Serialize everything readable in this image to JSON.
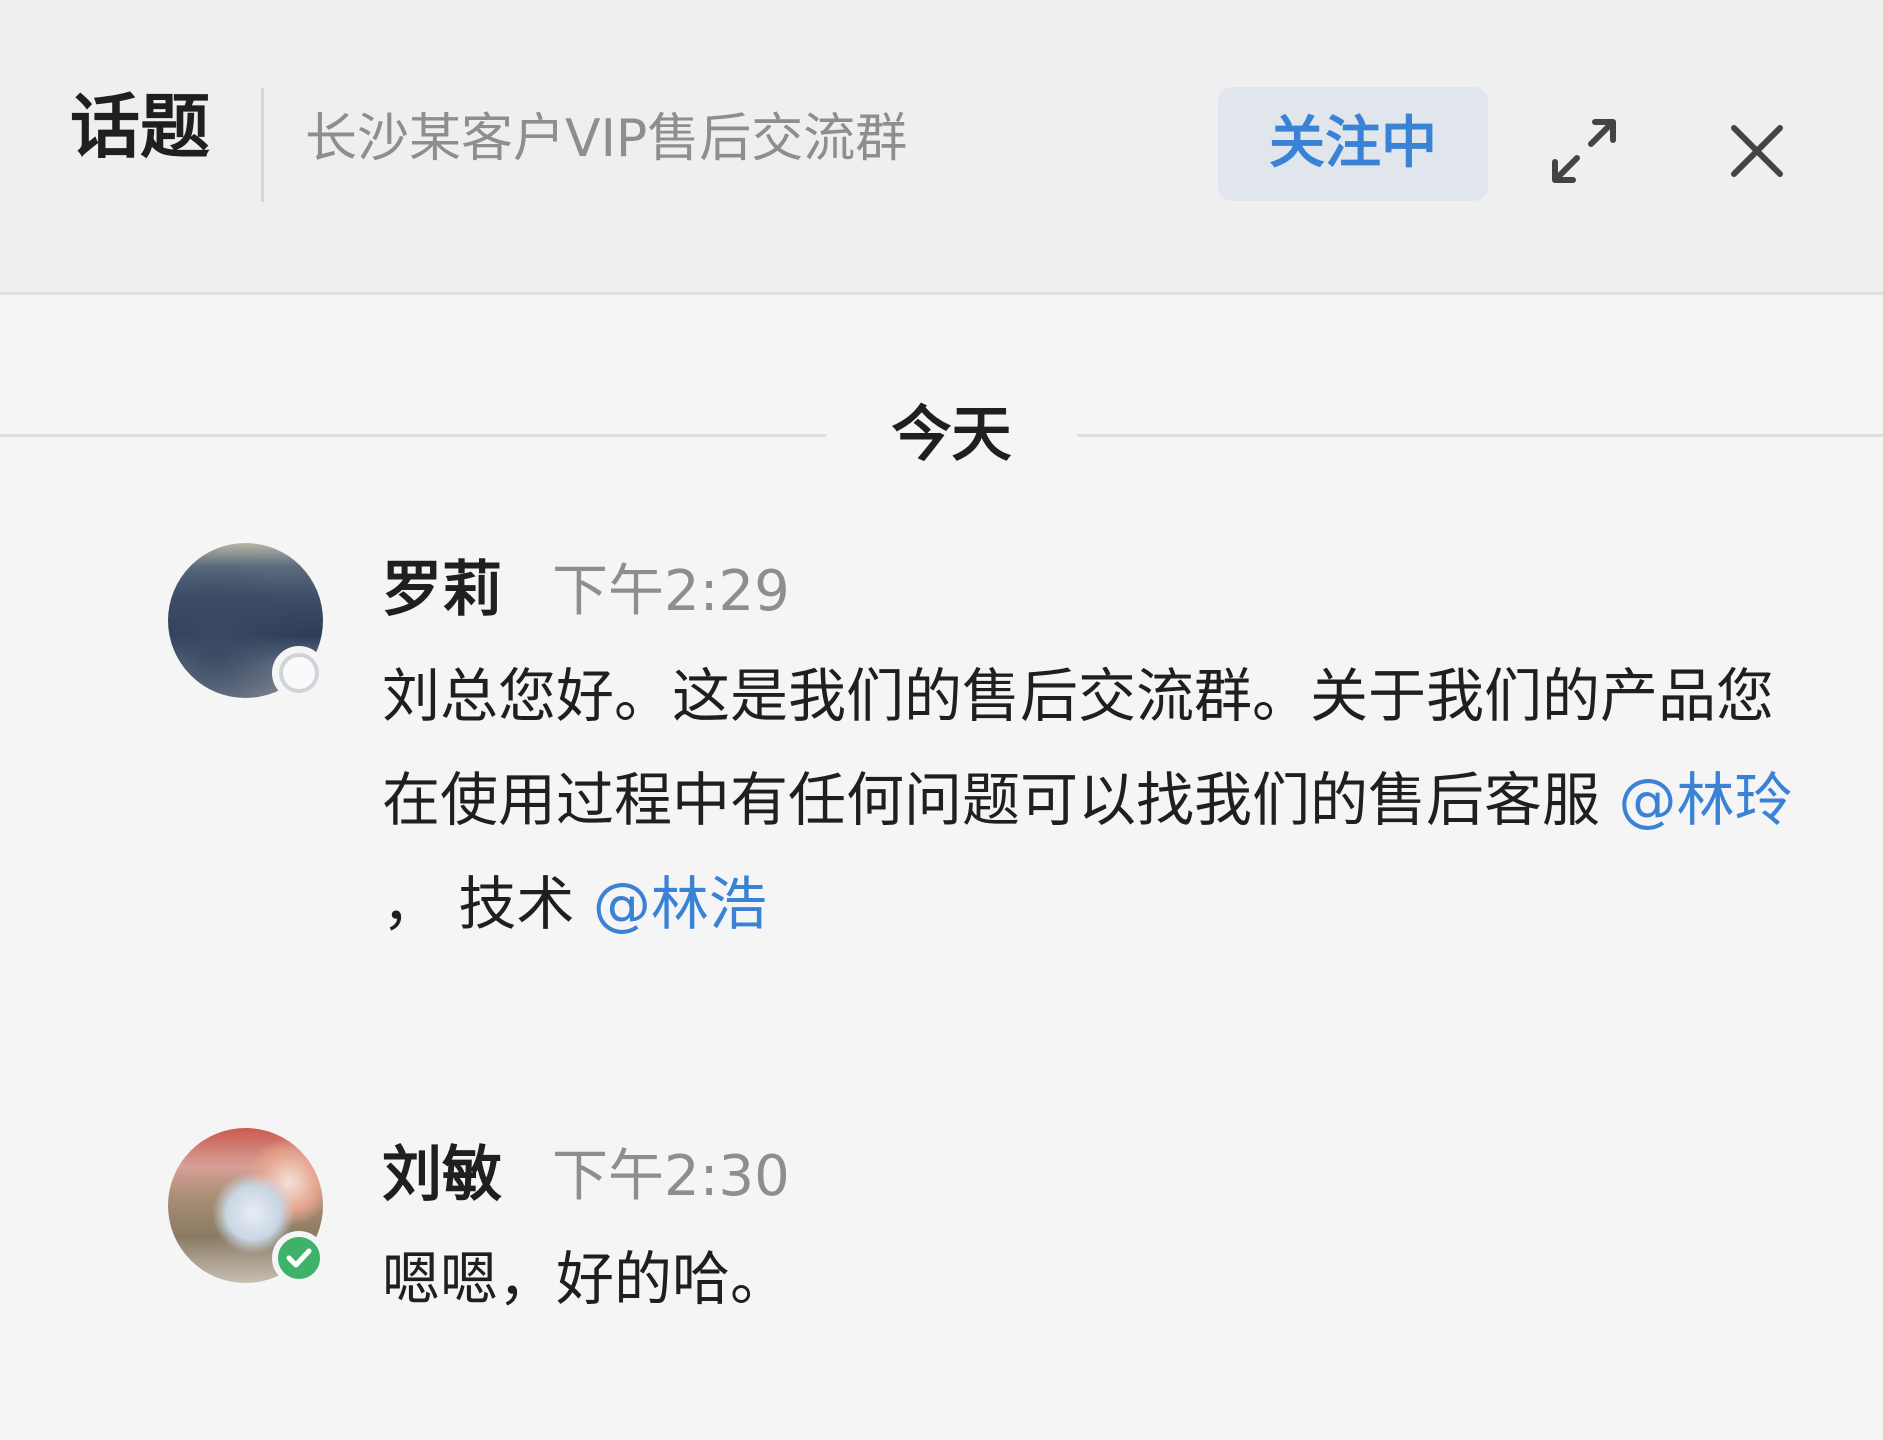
{
  "header": {
    "title": "话题",
    "group_name": "长沙某客户VIP售后交流群",
    "follow_label": "关注中",
    "expand_icon": "expand-icon",
    "close_icon": "close-icon",
    "accent_color": "#3a82d6"
  },
  "date_separator": "今天",
  "messages": [
    {
      "sender": "罗莉",
      "time": "下午2:29",
      "status": "offline",
      "text_part1": "刘总您好。这是我们的售后交流群。关于我们的产品您在使用过程中有任何问题可以找我们的售后客服 ",
      "mention1": "@林玲",
      "text_part2": " ， 技术 ",
      "mention2": "@林浩"
    },
    {
      "sender": "刘敏",
      "time": "下午2:30",
      "status": "online",
      "text": "嗯嗯，好的哈。"
    }
  ]
}
